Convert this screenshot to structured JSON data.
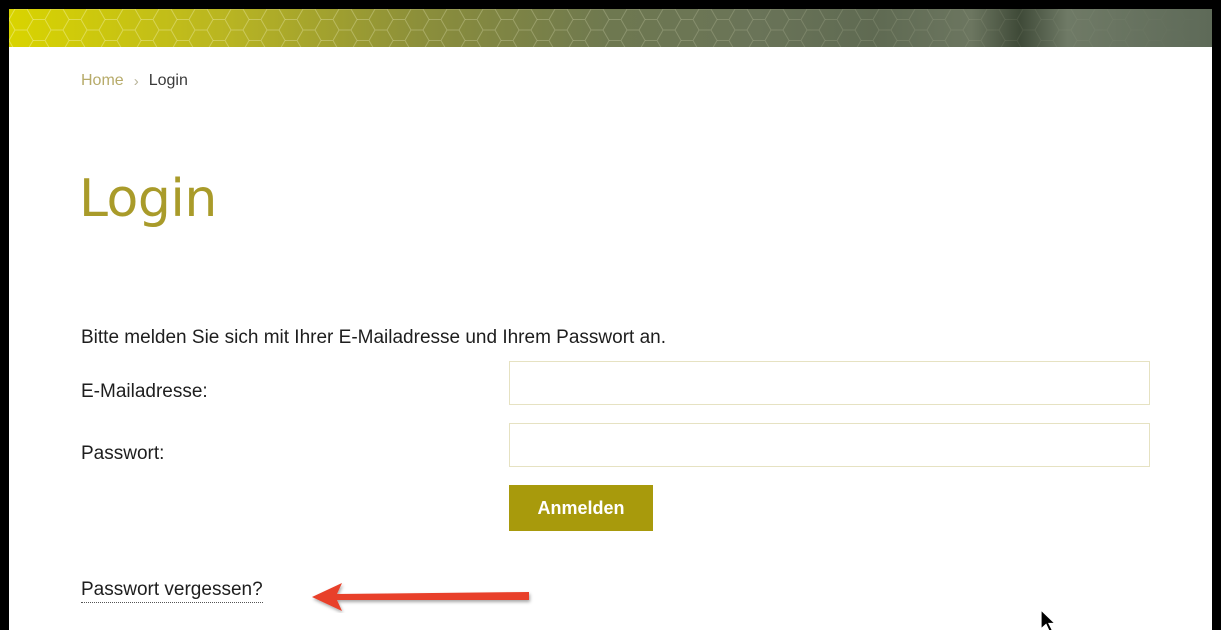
{
  "breadcrumb": {
    "home": "Home",
    "separator": "›",
    "current": "Login"
  },
  "page": {
    "title": "Login",
    "intro": "Bitte melden Sie sich mit Ihrer E-Mailadresse und Ihrem Passwort an."
  },
  "form": {
    "email_label": "E-Mailadresse:",
    "email_value": "",
    "password_label": "Passwort:",
    "password_value": "",
    "submit_label": "Anmelden",
    "forgot_link": "Passwort vergessen?"
  },
  "annotations": {
    "arrow_icon": "red-arrow-left-icon",
    "cursor_icon": "mouse-cursor-icon"
  },
  "colors": {
    "accent": "#a89a0c",
    "title": "#a99b2a",
    "breadcrumb_link": "#b7ab6a",
    "annotation_arrow": "#e8412a",
    "input_border": "#e6e2c2"
  }
}
